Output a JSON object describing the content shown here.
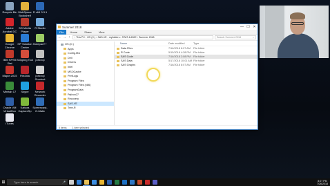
{
  "desktop": {
    "icons": [
      {
        "label": "Recycle Bin",
        "color": "#8aa4c0"
      },
      {
        "label": "Adobe Acrobat DC",
        "color": "#d4252b"
      },
      {
        "label": "Google Chrome",
        "color": "#e8b531"
      },
      {
        "label": "IBM SPSS Stat",
        "color": "#c0392b"
      },
      {
        "label": "Maple 2015",
        "color": "#c8342c"
      },
      {
        "label": "Minitab 17",
        "color": "#3a8c3a"
      },
      {
        "label": "Oracle VM VirtualBox",
        "color": "#2f5fa8"
      },
      {
        "label": "iTunes",
        "color": "#e8e8f0"
      },
      {
        "label": "WebSpace Bookshelf",
        "color": "#e2b13c"
      },
      {
        "label": "SG Media Player",
        "color": "#b83a2c"
      },
      {
        "label": "HP Solution Center",
        "color": "#2a7ad3"
      },
      {
        "label": "Snipping Tool",
        "color": "#d34e3c"
      },
      {
        "label": "FileZilla",
        "color": "#b8262b"
      },
      {
        "label": "Skype",
        "color": "#1fa0e0"
      },
      {
        "label": "Kaltura CaptureSp",
        "color": "#7fb83b"
      },
      {
        "label": "R x64 3.3.1",
        "color": "#2c68b5"
      },
      {
        "label": "R Studio",
        "color": "#75aadb"
      },
      {
        "label": "Notepad++",
        "color": "#9ccc65"
      },
      {
        "label": "pdfcrop",
        "color": "#c2c2c2"
      },
      {
        "label": "pdfcrop Shortcut",
        "color": "#d2d2d2"
      },
      {
        "label": "Network Recorder",
        "color": "#c6282c"
      },
      {
        "label": "Screencast-O-Matic",
        "color": "#2f6db7"
      }
    ]
  },
  "explorer": {
    "title": "Summer 2018",
    "controls": {
      "minimize": "—",
      "maximize": "☐",
      "close": "✕"
    },
    "ribbon_tabs": [
      "File",
      "Home",
      "Share",
      "View"
    ],
    "nav_buttons": {
      "back": "←",
      "forward": "→",
      "up": "↑"
    },
    "address": "›  This PC  ›  OS (C:)  ›  SAS-VE  ›  myfolders  ›  STAT 4-630E  ›  Summer 2018",
    "search_placeholder": "Search Summer 2018",
    "search_icon": "⌕",
    "nav_pane": [
      {
        "label": "OS (C:)",
        "selected": false
      },
      {
        "label": "Apps",
        "selected": false
      },
      {
        "label": "Config.Msi",
        "selected": false
      },
      {
        "label": "Dell",
        "selected": false
      },
      {
        "label": "Drivers",
        "selected": false
      },
      {
        "label": "Intel",
        "selected": false
      },
      {
        "label": "MSOCache",
        "selected": false
      },
      {
        "label": "PerfLogs",
        "selected": false
      },
      {
        "label": "Program Files",
        "selected": false
      },
      {
        "label": "Program Files (x86)",
        "selected": false
      },
      {
        "label": "ProgramData",
        "selected": false
      },
      {
        "label": "Python27",
        "selected": false
      },
      {
        "label": "Recovery",
        "selected": false
      },
      {
        "label": "SAS-VE",
        "selected": true
      },
      {
        "label": "Tree-R",
        "selected": false
      }
    ],
    "columns": {
      "name": "Name",
      "date": "Date modified",
      "type": "Type"
    },
    "files": [
      {
        "name": "Data Files",
        "date": "7/16/2018 8:07 AM",
        "type": "File folder",
        "selected": false
      },
      {
        "name": "R Code",
        "date": "5/15/2018 4:38 PM",
        "type": "File folder",
        "selected": false
      },
      {
        "name": "SAS Code",
        "date": "7/16/2018 2:08 PM",
        "type": "File folder",
        "selected": true
      },
      {
        "name": "SAS Data",
        "date": "5/17/2018 10:01 AM",
        "type": "File folder",
        "selected": false
      },
      {
        "name": "SAS Graphs",
        "date": "7/16/2018 8:07 AM",
        "type": "File folder",
        "selected": false
      }
    ],
    "status": {
      "count": "5 items",
      "selection": "1 item selected"
    }
  },
  "taskbar": {
    "start_icon": "⊞",
    "search_placeholder": "Type here to search",
    "mic_icon": "🎤",
    "apps": [
      {
        "name": "task-view-icon",
        "color": "#cfcfcf"
      },
      {
        "name": "edge-icon",
        "color": "#2f7fd8"
      },
      {
        "name": "file-explorer-icon",
        "color": "#e8c15a"
      },
      {
        "name": "store-icon",
        "color": "#3c8de0"
      },
      {
        "name": "chrome-icon",
        "color": "#e8b531"
      },
      {
        "name": "word-icon",
        "color": "#2b5fae"
      },
      {
        "name": "excel-icon",
        "color": "#237a45"
      },
      {
        "name": "outlook-icon",
        "color": "#1d6fc2"
      },
      {
        "name": "sas-icon",
        "color": "#2f77c4"
      },
      {
        "name": "powerpoint-icon",
        "color": "#c84a2a"
      },
      {
        "name": "acrobat-icon",
        "color": "#c92a2a"
      },
      {
        "name": "teams-icon",
        "color": "#5b5fc7"
      }
    ],
    "time": "8:07 PM",
    "date": "7/26/2018"
  }
}
